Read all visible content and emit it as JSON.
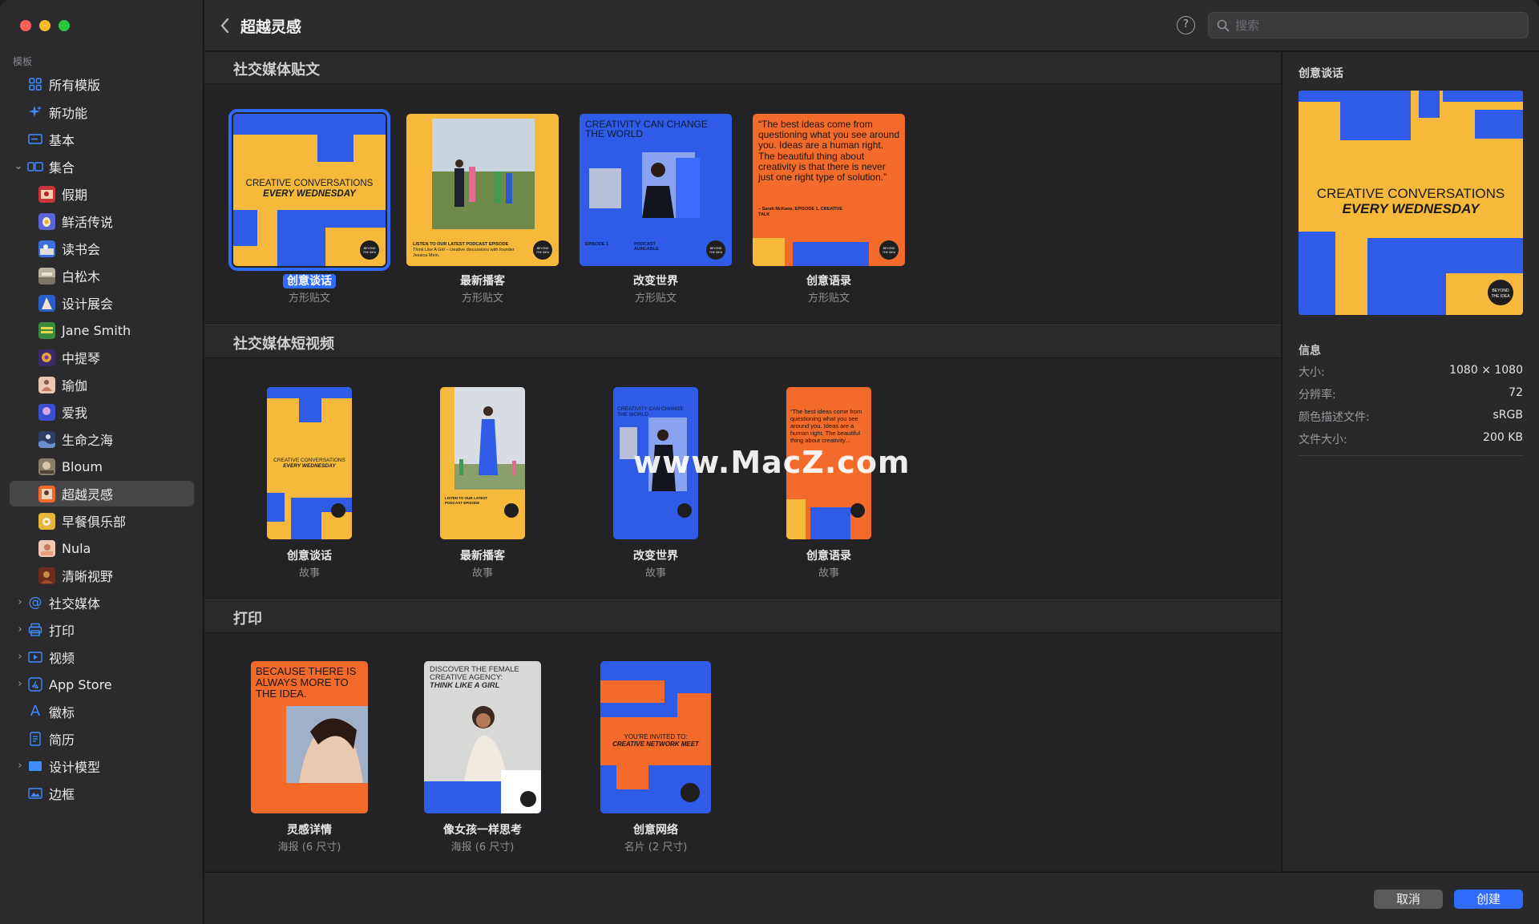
{
  "window": {
    "title": "超越灵感"
  },
  "search": {
    "placeholder": "搜索"
  },
  "toolbar": {
    "help_label": "?"
  },
  "sidebar": {
    "header": "模板",
    "items": [
      {
        "label": "所有模版",
        "icon": "grid-icon"
      },
      {
        "label": "新功能",
        "icon": "sparkle-icon"
      },
      {
        "label": "基本",
        "icon": "screen-icon"
      },
      {
        "label": "集合",
        "icon": "collection-icon",
        "expanded": true
      },
      {
        "label": "假期",
        "icon": "thumbnail-icon"
      },
      {
        "label": "鲜活传说",
        "icon": "thumbnail-icon"
      },
      {
        "label": "读书会",
        "icon": "thumbnail-icon"
      },
      {
        "label": "白松木",
        "icon": "thumbnail-icon"
      },
      {
        "label": "设计展会",
        "icon": "thumbnail-icon"
      },
      {
        "label": "Jane Smith",
        "icon": "thumbnail-icon"
      },
      {
        "label": "中提琴",
        "icon": "thumbnail-icon"
      },
      {
        "label": "瑜伽",
        "icon": "thumbnail-icon"
      },
      {
        "label": "爱我",
        "icon": "thumbnail-icon"
      },
      {
        "label": "生命之海",
        "icon": "thumbnail-icon"
      },
      {
        "label": "Bloum",
        "icon": "thumbnail-icon"
      },
      {
        "label": "超越灵感",
        "icon": "thumbnail-icon",
        "selected": true
      },
      {
        "label": "早餐俱乐部",
        "icon": "thumbnail-icon"
      },
      {
        "label": "Nula",
        "icon": "thumbnail-icon"
      },
      {
        "label": "清晰视野",
        "icon": "thumbnail-icon"
      },
      {
        "label": "社交媒体",
        "icon": "at-icon"
      },
      {
        "label": "打印",
        "icon": "printer-icon"
      },
      {
        "label": "视频",
        "icon": "video-icon"
      },
      {
        "label": "App Store",
        "icon": "app-store-icon"
      },
      {
        "label": "徽标",
        "icon": "logo-icon"
      },
      {
        "label": "简历",
        "icon": "document-icon"
      },
      {
        "label": "设计模型",
        "icon": "mockup-icon"
      },
      {
        "label": "边框",
        "icon": "frame-icon"
      }
    ]
  },
  "sections": [
    {
      "title": "社交媒体贴文",
      "templates": [
        {
          "name": "创意谈话",
          "type": "方形贴文",
          "text1": "CREATIVE CONVERSATIONS",
          "text2": "EVERY WEDNESDAY",
          "badge": "BEYOND THE IDEA"
        },
        {
          "name": "最新播客",
          "type": "方形贴文",
          "text1": "LISTEN TO OUR LATEST PODCAST EPISODE",
          "text2": "Think Like A Girl – creative discussions with founder Jessica Mein.",
          "badge": "BEYOND THE IDEA"
        },
        {
          "name": "改变世界",
          "type": "方形贴文",
          "text1": "CREATIVITY CAN CHANGE THE WORLD",
          "text2": "EPISODE 1",
          "text3": "PODCAST AVAILABLE",
          "badge": "BEYOND THE IDEA"
        },
        {
          "name": "创意语录",
          "type": "方形贴文",
          "text1": "“The best ideas come from questioning what you see around you. Ideas are a human right. The beautiful thing about creativity is that there is never just one right type of solution.”",
          "text2": "– Sarah McKane, EPISODE 1, CREATIVE TALK",
          "badge": "BEYOND THE IDEA"
        }
      ]
    },
    {
      "title": "社交媒体短视频",
      "templates": [
        {
          "name": "创意谈话",
          "type": "故事",
          "text1": "CREATIVE CONVERSATIONS",
          "text2": "EVERY WEDNESDAY"
        },
        {
          "name": "最新播客",
          "type": "故事",
          "text1": "LISTEN TO OUR LATEST PODCAST EPISODE"
        },
        {
          "name": "改变世界",
          "type": "故事",
          "text1": "CREATIVITY CAN CHANGE THE WORLD"
        },
        {
          "name": "创意语录",
          "type": "故事",
          "text1": "“The best ideas come from questioning what you see around you. Ideas are a human right. The beautiful thing about creativity..."
        }
      ]
    },
    {
      "title": "打印",
      "templates": [
        {
          "name": "灵感详情",
          "type": "海报 (6 尺寸)",
          "text1": "BECAUSE THERE IS ALWAYS MORE TO THE IDEA."
        },
        {
          "name": "像女孩一样思考",
          "type": "海报 (6 尺寸)",
          "text1": "DISCOVER THE FEMALE CREATIVE AGENCY:",
          "text2": "THINK LIKE A GIRL"
        },
        {
          "name": "创意网络",
          "type": "名片 (2 尺寸)",
          "text1": "YOU'RE INVITED TO:",
          "text2": "CREATIVE NETWORK MEET"
        }
      ]
    }
  ],
  "inspector": {
    "title": "创意谈话",
    "preview_text1": "CREATIVE CONVERSATIONS",
    "preview_text2": "EVERY WEDNESDAY",
    "badge": "BEYOND THE IDEA",
    "info_header": "信息",
    "info": [
      {
        "label": "大小:",
        "value": "1080 × 1080"
      },
      {
        "label": "分辨率:",
        "value": "72"
      },
      {
        "label": "颜色描述文件:",
        "value": "sRGB"
      },
      {
        "label": "文件大小:",
        "value": "200 KB"
      }
    ]
  },
  "buttons": {
    "cancel": "取消",
    "create": "创建"
  },
  "watermark": "www.MacZ.com",
  "colors": {
    "accent": "#2f6bff",
    "yellow": "#f6b93b",
    "blue": "#2f5be6",
    "orange": "#f26b2a",
    "dark": "#1e1e1e"
  }
}
